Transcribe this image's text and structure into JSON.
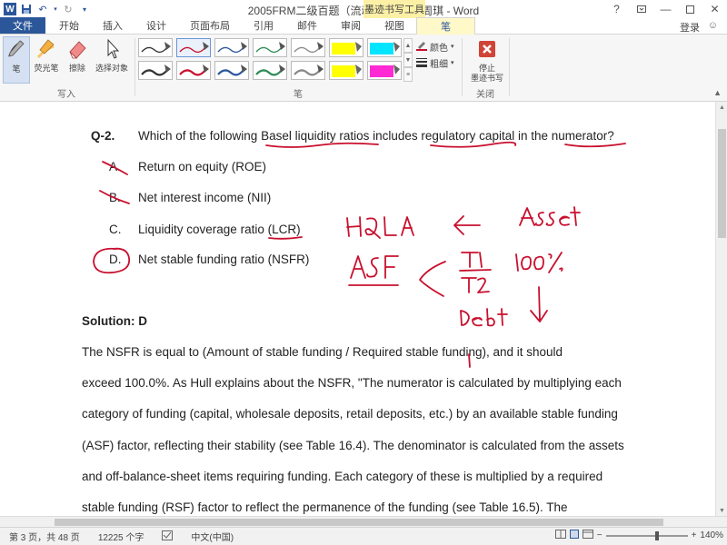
{
  "window": {
    "title": "2005FRM二级百题（流动性风险）_周琪 - Word",
    "contextual_group": "墨迹书写工具",
    "help_glyph": "?",
    "signin": "登录"
  },
  "tabs": [
    {
      "label": "文件"
    },
    {
      "label": "开始"
    },
    {
      "label": "插入"
    },
    {
      "label": "设计"
    },
    {
      "label": "页面布局"
    },
    {
      "label": "引用"
    },
    {
      "label": "邮件"
    },
    {
      "label": "审阅"
    },
    {
      "label": "视图"
    },
    {
      "label": "笔"
    }
  ],
  "ribbon": {
    "write_group": {
      "label": "写入",
      "pen": "笔",
      "highlighter": "荧光笔",
      "eraser": "擦除",
      "select_objects": "选择对象"
    },
    "pens_group": {
      "label": "笔",
      "color": "颜色",
      "thickness": "粗细"
    },
    "close_group": {
      "label": "关闭",
      "stop_inking_line1": "停止",
      "stop_inking_line2": "墨迹书写"
    }
  },
  "document": {
    "question_label": "Q-2.",
    "question_text": "Which of the following Basel liquidity ratios includes regulatory capital in the numerator?",
    "options": [
      {
        "letter": "A.",
        "text": "Return on equity (ROE)"
      },
      {
        "letter": "B.",
        "text": "Net interest income (NII)"
      },
      {
        "letter": "C.",
        "text": "Liquidity coverage ratio (LCR)"
      },
      {
        "letter": "D.",
        "text": "Net stable funding ratio (NSFR)"
      }
    ],
    "solution_heading": "Solution: D",
    "paragraph_lines": [
      "The NSFR is equal to (Amount of stable funding / Required stable funding), and it should",
      "exceed 100.0%. As Hull explains about the NSFR, \"The numerator is calculated by multiplying each",
      "category of funding (capital, wholesale deposits, retail deposits, etc.) by an available stable funding",
      "(ASF) factor, reflecting their stability (see Table 16.4). The denominator is calculated from the assets",
      "and off-balance-sheet items requiring funding. Each category of these is multiplied by a required",
      "stable funding (RSF) factor to reflect the permanence of the funding (see Table 16.5). The"
    ]
  },
  "handwriting": {
    "hqla": "HQLA",
    "asset": "Asset",
    "asf": "ASF",
    "t1": "T1",
    "t2": "T2",
    "percent": "100%",
    "debt": "Debt"
  },
  "status": {
    "page": "第 3 页，共 48 页",
    "words": "12225 个字",
    "language": "中文(中国)",
    "zoom": "140%"
  },
  "colors": {
    "accent": "#2b579a",
    "ink": "#c8102e"
  }
}
